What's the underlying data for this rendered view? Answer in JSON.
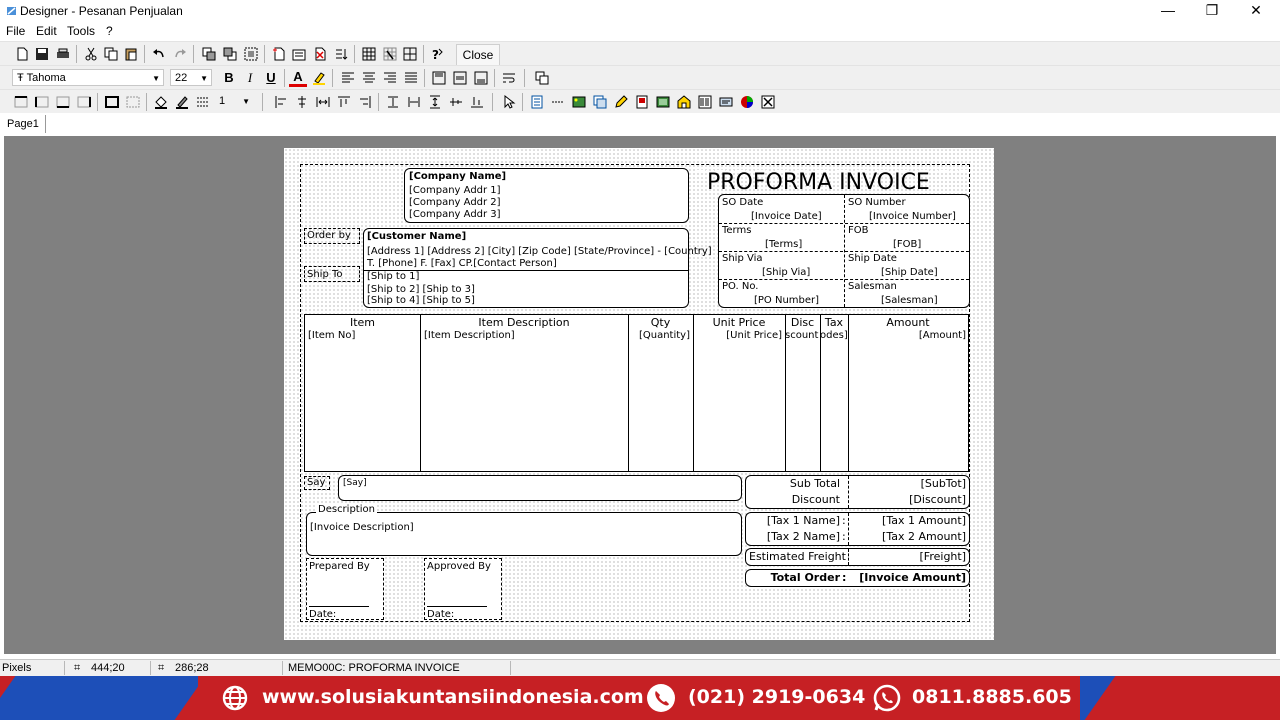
{
  "window": {
    "title": "Designer - Pesanan Penjualan",
    "minimize": "—",
    "restore": "❐",
    "close": "✕"
  },
  "menu": {
    "file": "File",
    "edit": "Edit",
    "tools": "Tools",
    "help": "?"
  },
  "toolbar": {
    "close_label": "Close"
  },
  "format": {
    "font_name": "Tahoma",
    "font_size": "22",
    "bold": "B",
    "italic": "I",
    "underline": "U",
    "font_color": "A",
    "line_width": "1"
  },
  "tabs": {
    "page1": "Page1"
  },
  "report": {
    "title": "PROFORMA INVOICE",
    "company": {
      "name": "[Company Name]",
      "addr1": "[Company Addr 1]",
      "addr2": "[Company Addr 2]",
      "addr3": "[Company Addr 3]"
    },
    "order_by_label": "Order by",
    "ship_to_label": "Ship To",
    "customer": {
      "name": "[Customer Name]",
      "address": "[Address 1] [Address 2] [City] [Zip Code] [State/Province] - [Country]",
      "contact": "T. [Phone]  F. [Fax]  CP.[Contact Person]"
    },
    "ship": {
      "line1": "[Ship to 1]",
      "line2": "[Ship to 2]  [Ship to 3]",
      "line3": "[Ship to 4]  [Ship to 5]"
    },
    "info": {
      "so_date_label": "SO Date",
      "so_date_value": "[Invoice Date]",
      "so_number_label": "SO Number",
      "so_number_value": "[Invoice Number]",
      "terms_label": "Terms",
      "terms_value": "[Terms]",
      "fob_label": "FOB",
      "fob_value": "[FOB]",
      "ship_via_label": "Ship Via",
      "ship_via_value": "[Ship Via]",
      "ship_date_label": "Ship Date",
      "ship_date_value": "[Ship Date]",
      "po_label": "PO. No.",
      "po_value": "[PO Number]",
      "salesman_label": "Salesman",
      "salesman_value": "[Salesman]"
    },
    "columns": {
      "headers": [
        "Item",
        "Item Description",
        "Qty",
        "Unit Price",
        "Disc",
        "Tax",
        "Amount"
      ],
      "fields": [
        "[Item No]",
        "[Item Description]",
        "[Quantity]",
        "[Unit Price]",
        "scount]",
        "odes]",
        "[Amount]"
      ]
    },
    "say_label": "Say",
    "say_value": "[Say]",
    "description_label": "Description",
    "description_value": "[Invoice Description]",
    "prepared_by": "Prepared By",
    "approved_by": "Approved By",
    "date_label": "Date:",
    "totals": {
      "subtotal_label": "Sub Total",
      "subtotal_value": "[SubTot]",
      "discount_label": "Discount",
      "discount_value": "[Discount]",
      "tax1_label": "[Tax 1 Name]",
      "tax1_value": "[Tax 1 Amount]",
      "tax2_label": "[Tax 2 Name]",
      "tax2_value": "[Tax 2 Amount]",
      "freight_label": "Estimated Freight",
      "freight_value": "[Freight]",
      "total_label": "Total Order",
      "total_value": "[Invoice Amount]",
      "colon": ":"
    }
  },
  "status": {
    "units": "Pixels",
    "position": "444;20",
    "size": "286;28",
    "object": "MEMO00C: PROFORMA INVOICE"
  },
  "banner": {
    "website": "www.solusiakuntansiindonesia.com",
    "phone": "(021) 2919-0634",
    "whatsapp": "0811.8885.605"
  }
}
